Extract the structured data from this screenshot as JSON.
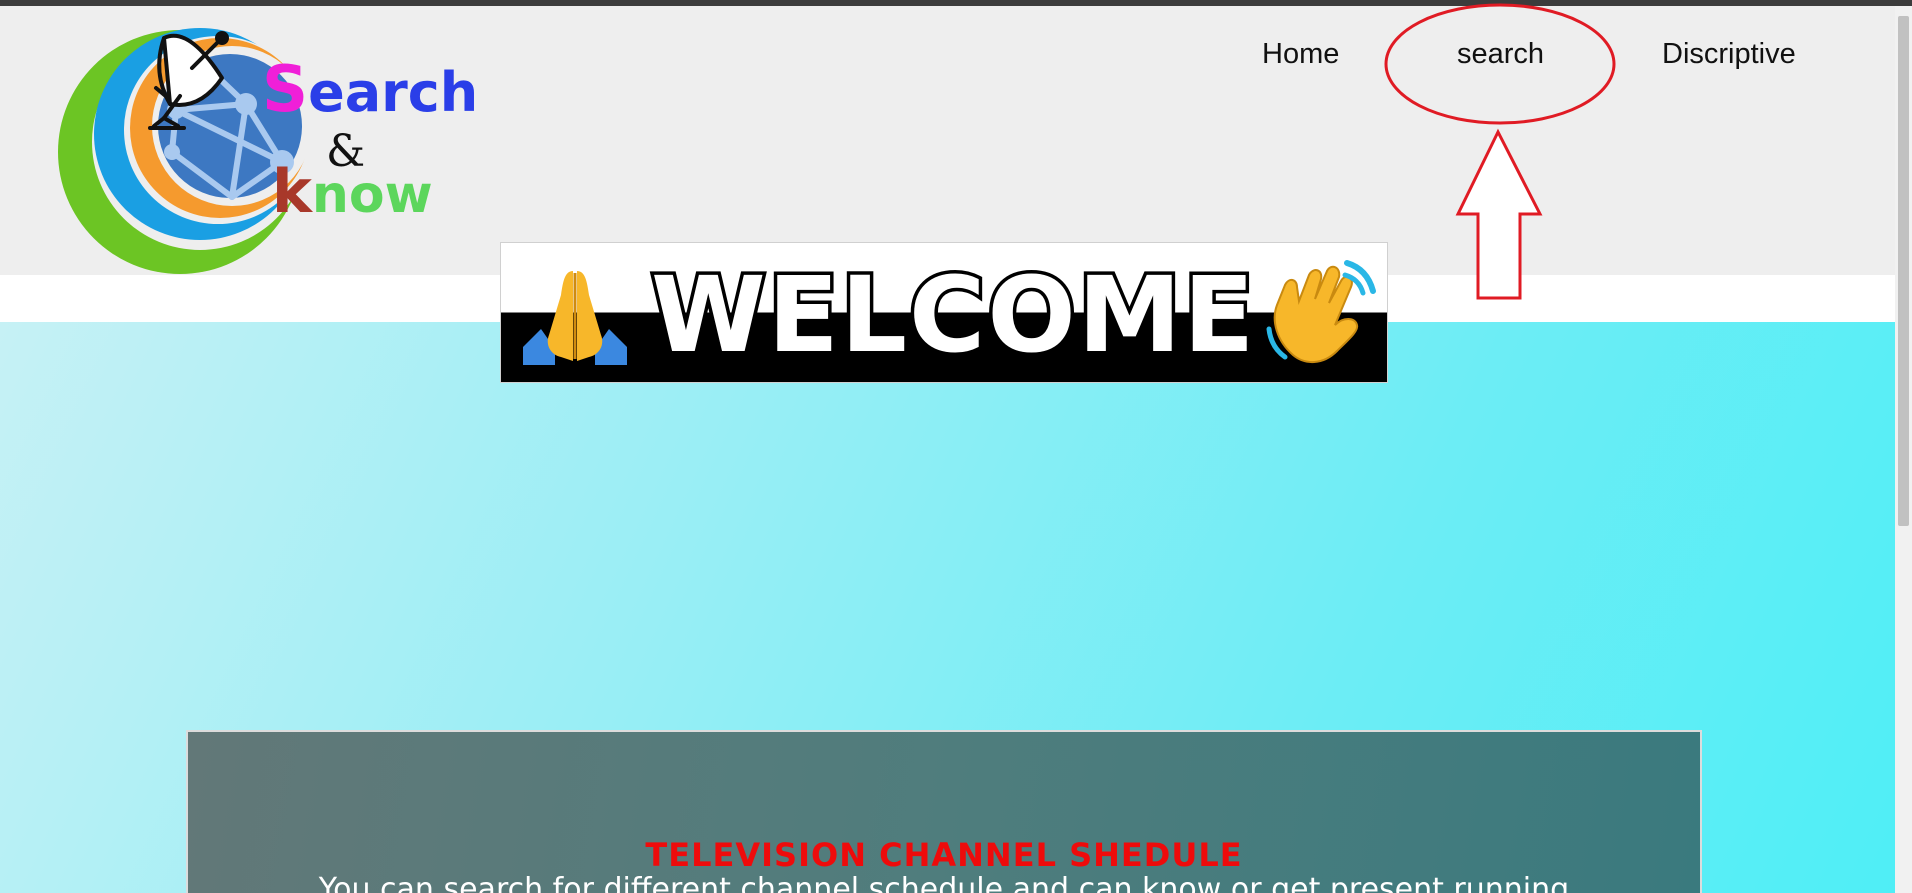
{
  "logo": {
    "word_search": "Search",
    "word_and": "&",
    "word_know": "know"
  },
  "nav": {
    "home": "Home",
    "search": "search",
    "discriptive": "Discriptive"
  },
  "banner": {
    "welcome": "WELCOME"
  },
  "schedule": {
    "title": "TELEVISION CHANNEL SHEDULE",
    "description": "You can search for different channel schedule and can know or get present running"
  },
  "colors": {
    "header_bg": "#eeeeee",
    "hero_gradient_start": "#c6f1f5",
    "hero_gradient_end": "#4feef6",
    "annotation_red": "#e01b24",
    "schedule_title": "#ee0b0b"
  },
  "icons": {
    "logo_dish": "satellite-dish-icon",
    "logo_globe": "globe-network-icon",
    "banner_left": "folded-hands-icon",
    "banner_right": "waving-hand-icon"
  }
}
